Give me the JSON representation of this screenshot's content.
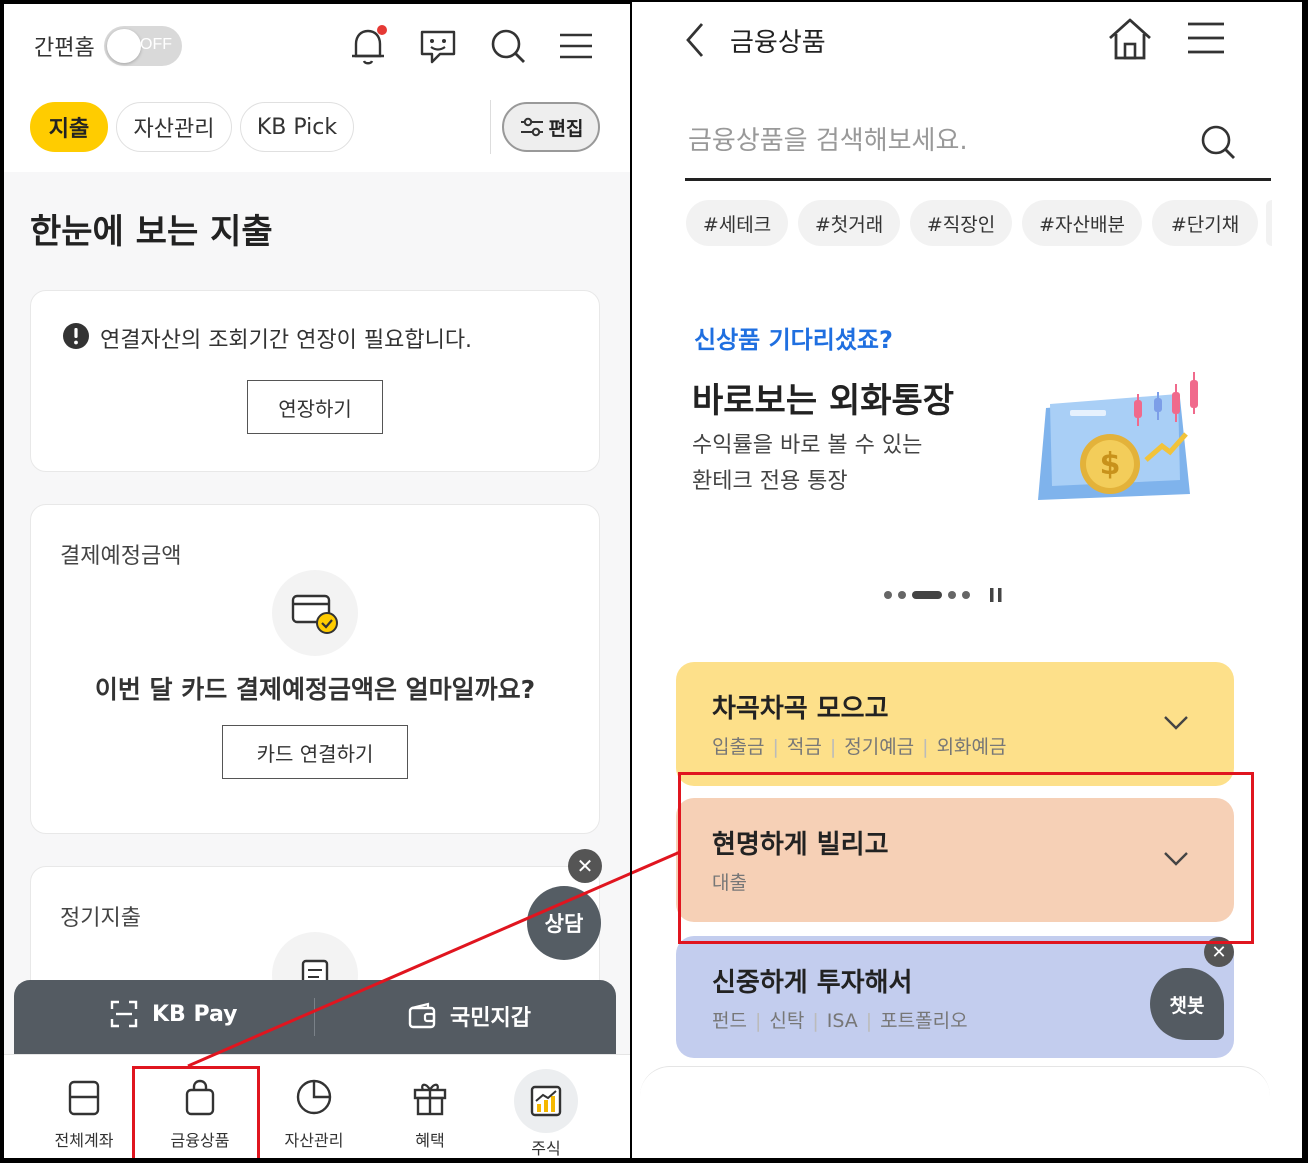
{
  "left": {
    "header": {
      "easy_home_label": "간편홈",
      "toggle_text": "OFF"
    },
    "tabs": [
      {
        "label": "지출"
      },
      {
        "label": "자산관리"
      },
      {
        "label": "KB Pick"
      }
    ],
    "edit_label": "편집",
    "page_title": "한눈에 보는 지출",
    "notice": {
      "text": "연결자산의 조회기간 연장이 필요합니다.",
      "button": "연장하기"
    },
    "payment_card": {
      "label": "결제예정금액",
      "question": "이번 달 카드 결제예정금액은 얼마일까요?",
      "button": "카드 연결하기"
    },
    "regular_card": {
      "label": "정기지출"
    },
    "consult_label": "상담",
    "close_glyph": "✕",
    "pay_bar": {
      "kbpay": "KB Pay",
      "wallet": "국민지갑"
    },
    "bottom_nav": [
      {
        "label": "전체계좌",
        "icon": "wallet-icon"
      },
      {
        "label": "금융상품",
        "icon": "bag-icon"
      },
      {
        "label": "자산관리",
        "icon": "pie-chart-icon"
      },
      {
        "label": "혜택",
        "icon": "gift-icon"
      },
      {
        "label": "주식",
        "icon": "stock-chart-icon"
      }
    ]
  },
  "right": {
    "title": "금융상품",
    "search_placeholder": "금융상품을 검색해보세요.",
    "tags": [
      "#세테크",
      "#첫거래",
      "#직장인",
      "#자산배분",
      "#단기채"
    ],
    "promo": {
      "subtitle": "신상품 기다리셨죠?",
      "title": "바로보는 외화통장",
      "desc_line1": "수익률을 바로 볼 수 있는",
      "desc_line2": "환테크 전용 통장"
    },
    "categories": [
      {
        "title": "차곡차곡 모으고",
        "items": [
          "입출금",
          "적금",
          "정기예금",
          "외화예금"
        ],
        "color": "#fde08a"
      },
      {
        "title": "현명하게 빌리고",
        "items": [
          "대출"
        ],
        "color": "#f6d0b6"
      },
      {
        "title": "신중하게 투자해서",
        "items": [
          "펀드",
          "신탁",
          "ISA",
          "포트폴리오"
        ],
        "color": "#c3cdee"
      }
    ],
    "chatbot_label": "챗봇",
    "close_glyph": "✕"
  },
  "colors": {
    "accent_yellow": "#ffcc00",
    "highlight_red": "#e0151f",
    "promo_blue": "#1f6fe0"
  }
}
